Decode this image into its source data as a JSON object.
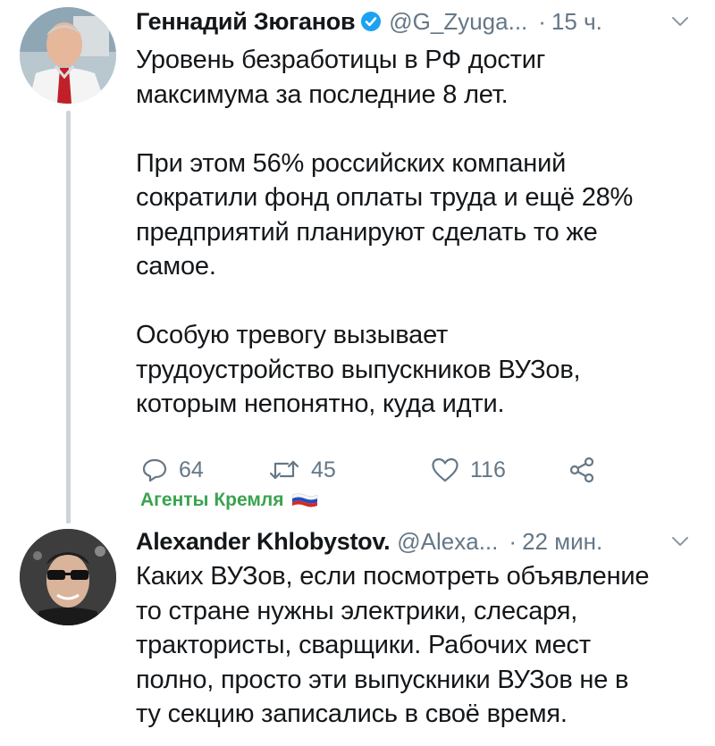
{
  "tweets": [
    {
      "author_name": "Геннадий Зюганов",
      "handle": "@G_Zyuga...",
      "separator": "·",
      "time": "15 ч.",
      "text": "Уровень безработицы в РФ достиг\nмаксимума за последние 8 лет.\n\nПри этом 56% российских компаний\nсократили фонд оплаты труда и ещё 28%\nпредприятий планируют сделать то же\nсамое.\n\nОсобую тревогу вызывает\nтрудоустройство выпускников ВУЗов,\nкоторым непонятно, куда идти.",
      "actions": {
        "reply_count": "64",
        "retweet_count": "45",
        "like_count": "116"
      }
    },
    {
      "author_name": "Alexander Khlobystov.",
      "handle": "@Alexa...",
      "separator": "·",
      "time": "22 мин.",
      "text": "Каких ВУЗов, если посмотреть объявление\nто стране нужны электрики, слесаря,\nтрактористы, сварщики. Рабочих мест\nполно, просто эти выпускники ВУЗов не в\nту секцию записались в своё время."
    }
  ],
  "overlay_label": "Агенты Кремля",
  "colors": {
    "text": "#14171a",
    "muted": "#657786",
    "verified": "#1da1f2",
    "thread_line": "#cdd3d8",
    "label_green": "#3aa34f"
  },
  "icons": [
    "verified-badge-icon",
    "chevron-down-icon",
    "reply-icon",
    "retweet-icon",
    "like-icon",
    "share-icon",
    "russian-flag-icon"
  ]
}
